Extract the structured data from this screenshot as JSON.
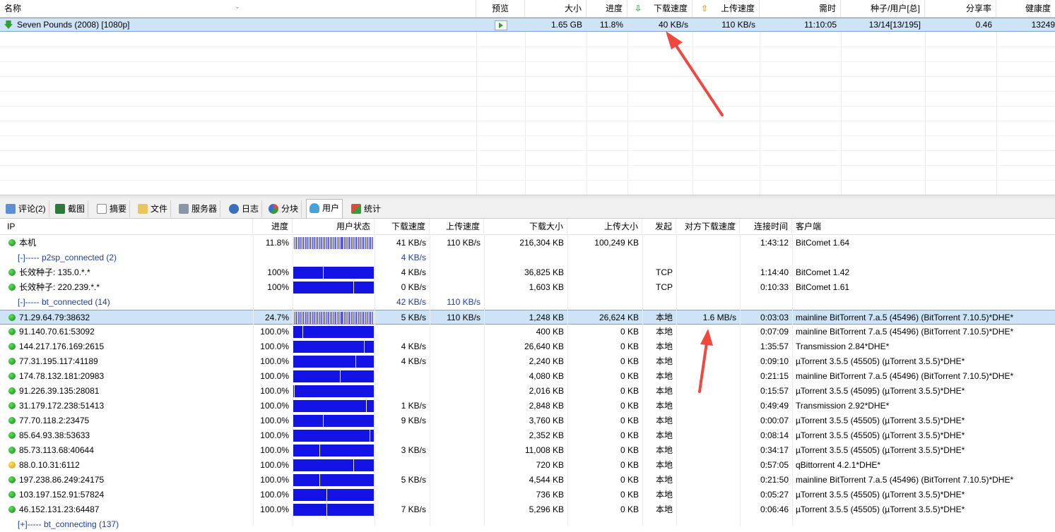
{
  "task_list": {
    "columns": {
      "name": "名称",
      "preview": "预览",
      "size": "大小",
      "progress": "进度",
      "download_speed": "下载速度",
      "upload_speed": "上传速度",
      "time_left": "需时",
      "seeds_peers": "种子/用户[总]",
      "share_ratio": "分享率",
      "health": "健康度"
    },
    "task": {
      "name": "Seven Pounds (2008) [1080p]",
      "size": "1.65 GB",
      "progress": "11.8%",
      "download_speed": "40 KB/s",
      "upload_speed": "110 KB/s",
      "time_left": "11:10:05",
      "seeds_peers": "13/14[13/195]",
      "share_ratio": "0.46",
      "health": "13249"
    }
  },
  "tabs": [
    {
      "label": "评论(2)",
      "icon": "comment-icon"
    },
    {
      "label": "截图",
      "icon": "screenshot-icon"
    },
    {
      "label": "摘要",
      "icon": "summary-icon"
    },
    {
      "label": "文件",
      "icon": "file-icon"
    },
    {
      "label": "服务器",
      "icon": "server-icon"
    },
    {
      "label": "日志",
      "icon": "log-icon"
    },
    {
      "label": "分块",
      "icon": "pieces-icon"
    },
    {
      "label": "用户",
      "icon": "users-icon"
    },
    {
      "label": "统计",
      "icon": "stats-icon"
    }
  ],
  "active_tab": "用户",
  "peer_table": {
    "columns": {
      "ip": "IP",
      "progress": "进度",
      "user_status": "用户状态",
      "download_speed": "下载速度",
      "upload_speed": "上传速度",
      "downloaded": "下载大小",
      "uploaded": "上传大小",
      "initiator": "发起",
      "remote_dl_speed": "对方下载速度",
      "connect_time": "连接时间",
      "client": "客户端"
    },
    "rows": [
      {
        "type": "peer",
        "ip": "本机",
        "progress": "11.8%",
        "dl": "41 KB/s",
        "ul": "110 KB/s",
        "down": "216,304 KB",
        "up": "100,249 KB",
        "init": "",
        "remote": "",
        "time": "1:43:12",
        "client": "BitComet 1.64",
        "bar": "striped",
        "fill": 0.118,
        "icon": "green"
      },
      {
        "type": "group",
        "label": "[-]----- p2sp_connected (2)",
        "dl": "4 KB/s",
        "ul": ""
      },
      {
        "type": "peer",
        "ip": "长效种子: 135.0.*.*",
        "progress": "100%",
        "dl": "4 KB/s",
        "ul": "",
        "down": "36,825 KB",
        "up": "",
        "init": "TCP",
        "remote": "",
        "time": "1:14:40",
        "client": "BitComet 1.42",
        "bar": "solid",
        "marks": [
          0.37
        ],
        "icon": "green"
      },
      {
        "type": "peer",
        "ip": "长效种子: 220.239.*.*",
        "progress": "100%",
        "dl": "0 KB/s",
        "ul": "",
        "down": "1,603 KB",
        "up": "",
        "init": "TCP",
        "remote": "",
        "time": "0:10:33",
        "client": "BitComet 1.61",
        "bar": "solid",
        "marks": [
          0.75
        ],
        "icon": "green"
      },
      {
        "type": "group",
        "label": "[-]----- bt_connected (14)",
        "dl": "42 KB/s",
        "ul": "110 KB/s"
      },
      {
        "type": "peer",
        "ip": "71.29.64.79:38632",
        "progress": "24.7%",
        "dl": "5 KB/s",
        "ul": "110 KB/s",
        "down": "1,248 KB",
        "up": "26,624 KB",
        "init": "本地",
        "remote": "1.6 MB/s",
        "time": "0:03:03",
        "client": "mainline BitTorrent 7.a.5 (45496) (BitTorrent 7.10.5)*DHE*",
        "bar": "striped",
        "fill": 0.247,
        "icon": "green",
        "selected": true
      },
      {
        "type": "peer",
        "ip": "91.140.70.61:53092",
        "progress": "100.0%",
        "dl": "",
        "ul": "",
        "down": "400 KB",
        "up": "0 KB",
        "init": "本地",
        "remote": "",
        "time": "0:07:09",
        "client": "mainline BitTorrent 7.a.5 (45496) (BitTorrent 7.10.5)*DHE*",
        "bar": "solid",
        "marks": [
          0.12
        ],
        "icon": "green"
      },
      {
        "type": "peer",
        "ip": "144.217.176.169:2615",
        "progress": "100.0%",
        "dl": "4 KB/s",
        "ul": "",
        "down": "26,640 KB",
        "up": "0 KB",
        "init": "本地",
        "remote": "",
        "time": "1:35:57",
        "client": "Transmission 2.84*DHE*",
        "bar": "solid",
        "marks": [
          0.88
        ],
        "icon": "green"
      },
      {
        "type": "peer",
        "ip": "77.31.195.117:41189",
        "progress": "100.0%",
        "dl": "4 KB/s",
        "ul": "",
        "down": "2,240 KB",
        "up": "0 KB",
        "init": "本地",
        "remote": "",
        "time": "0:09:10",
        "client": "µTorrent 3.5.5 (45505) (µTorrent 3.5.5)*DHE*",
        "bar": "solid",
        "marks": [
          0.77
        ],
        "icon": "green"
      },
      {
        "type": "peer",
        "ip": "174.78.132.181:20983",
        "progress": "100.0%",
        "dl": "",
        "ul": "",
        "down": "4,080 KB",
        "up": "0 KB",
        "init": "本地",
        "remote": "",
        "time": "0:21:15",
        "client": "mainline BitTorrent 7.a.5 (45496) (BitTorrent 7.10.5)*DHE*",
        "bar": "solid",
        "marks": [
          0.58
        ],
        "icon": "green"
      },
      {
        "type": "peer",
        "ip": "91.226.39.135:28081",
        "progress": "100.0%",
        "dl": "",
        "ul": "",
        "down": "2,016 KB",
        "up": "0 KB",
        "init": "本地",
        "remote": "",
        "time": "0:15:57",
        "client": "µTorrent 3.5.5 (45095) (µTorrent 3.5.5)*DHE*",
        "bar": "solid",
        "marks": [
          0.02
        ],
        "icon": "green"
      },
      {
        "type": "peer",
        "ip": "31.179.172.238:51413",
        "progress": "100.0%",
        "dl": "1 KB/s",
        "ul": "",
        "down": "2,848 KB",
        "up": "0 KB",
        "init": "本地",
        "remote": "",
        "time": "0:49:49",
        "client": "Transmission 2.92*DHE*",
        "bar": "solid",
        "marks": [
          0.9
        ],
        "icon": "green"
      },
      {
        "type": "peer",
        "ip": "77.70.118.2:23475",
        "progress": "100.0%",
        "dl": "9 KB/s",
        "ul": "",
        "down": "3,760 KB",
        "up": "0 KB",
        "init": "本地",
        "remote": "",
        "time": "0:00:07",
        "client": "µTorrent 3.5.5 (45505) (µTorrent 3.5.5)*DHE*",
        "bar": "solid",
        "marks": [
          0.37
        ],
        "icon": "green"
      },
      {
        "type": "peer",
        "ip": "85.64.93.38:53633",
        "progress": "100.0%",
        "dl": "",
        "ul": "",
        "down": "2,352 KB",
        "up": "0 KB",
        "init": "本地",
        "remote": "",
        "time": "0:08:14",
        "client": "µTorrent 3.5.5 (45505) (µTorrent 3.5.5)*DHE*",
        "bar": "solid",
        "marks": [
          0.95
        ],
        "icon": "green"
      },
      {
        "type": "peer",
        "ip": "85.73.113.68:40644",
        "progress": "100.0%",
        "dl": "3 KB/s",
        "ul": "",
        "down": "11,008 KB",
        "up": "0 KB",
        "init": "本地",
        "remote": "",
        "time": "0:34:17",
        "client": "µTorrent 3.5.5 (45505) (µTorrent 3.5.5)*DHE*",
        "bar": "solid",
        "marks": [
          0.33
        ],
        "icon": "green"
      },
      {
        "type": "peer",
        "ip": "88.0.10.31:6112",
        "progress": "100.0%",
        "dl": "",
        "ul": "",
        "down": "720 KB",
        "up": "0 KB",
        "init": "本地",
        "remote": "",
        "time": "0:57:05",
        "client": "qBittorrent 4.2.1*DHE*",
        "bar": "solid",
        "marks": [
          0.75
        ],
        "icon": "yellow"
      },
      {
        "type": "peer",
        "ip": "197.238.86.249:24175",
        "progress": "100.0%",
        "dl": "5 KB/s",
        "ul": "",
        "down": "4,544 KB",
        "up": "0 KB",
        "init": "本地",
        "remote": "",
        "time": "0:21:50",
        "client": "mainline BitTorrent 7.a.5 (45496) (BitTorrent 7.10.5)*DHE*",
        "bar": "solid",
        "marks": [
          0.33
        ],
        "icon": "green"
      },
      {
        "type": "peer",
        "ip": "103.197.152.91:57824",
        "progress": "100.0%",
        "dl": "",
        "ul": "",
        "down": "736 KB",
        "up": "0 KB",
        "init": "本地",
        "remote": "",
        "time": "0:05:27",
        "client": "µTorrent 3.5.5 (45505) (µTorrent 3.5.5)*DHE*",
        "bar": "solid",
        "marks": [
          0.42
        ],
        "icon": "green"
      },
      {
        "type": "peer",
        "ip": "46.152.131.23:64487",
        "progress": "100.0%",
        "dl": "7 KB/s",
        "ul": "",
        "down": "5,296 KB",
        "up": "0 KB",
        "init": "本地",
        "remote": "",
        "time": "0:06:46",
        "client": "µTorrent 3.5.5 (45505) (µTorrent 3.5.5)*DHE*",
        "bar": "solid",
        "marks": [
          0.42
        ],
        "icon": "green"
      },
      {
        "type": "group",
        "label": "[+]----- bt_connecting (137)",
        "dl": "",
        "ul": ""
      }
    ]
  },
  "colors": {
    "selection": "#cfe3f7",
    "bar_fill": "#1313e6",
    "group_text": "#1a3fa8",
    "annotation_arrow": "#f0483e"
  }
}
